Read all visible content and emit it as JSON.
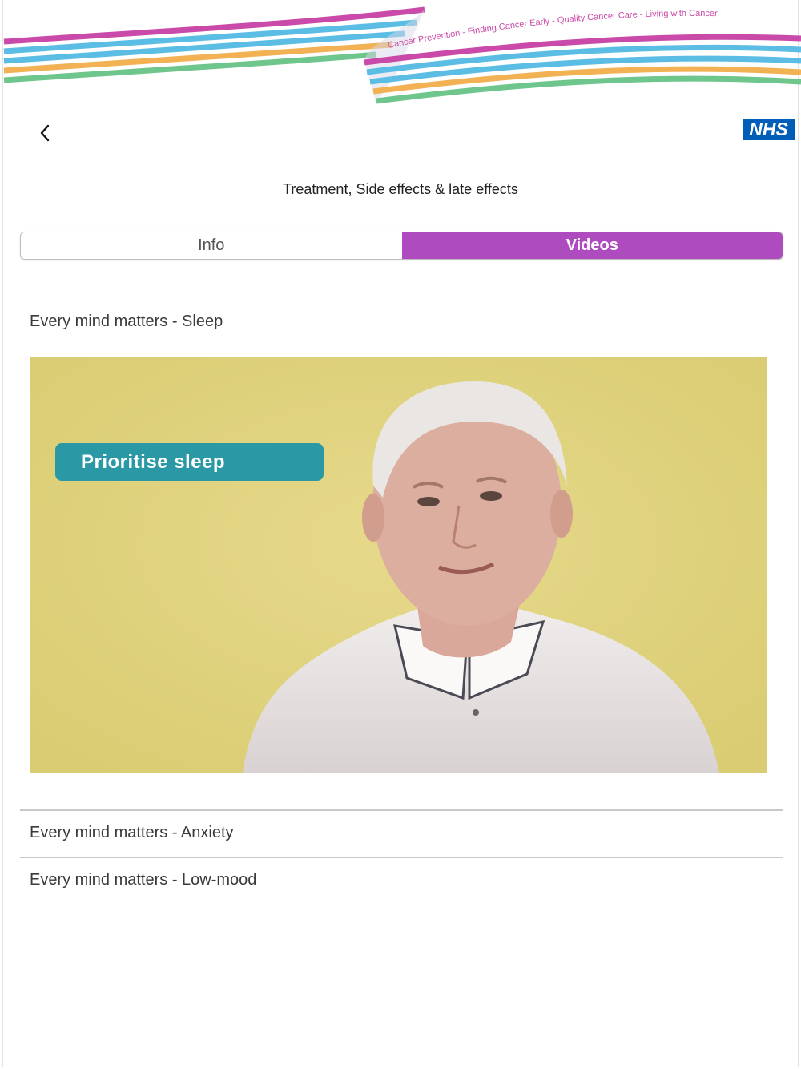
{
  "banner": {
    "tagline": "Cancer Prevention - Finding Cancer Early - Quality Cancer Care - Living with Cancer",
    "stripe_colors": [
      "#c94aa8",
      "#5bbde4",
      "#f2b254",
      "#6fc68c"
    ]
  },
  "header": {
    "back_icon": "chevron-left-icon",
    "logo_text": "NHS",
    "logo_color": "#005eb8",
    "title": "Treatment, Side effects & late effects"
  },
  "tabs": [
    {
      "label": "Info",
      "active": false
    },
    {
      "label": "Videos",
      "active": true
    }
  ],
  "accent_color": "#ad4bbf",
  "videos": {
    "expanded": {
      "title": "Every mind matters - Sleep",
      "caption": "Prioritise sleep"
    },
    "items": [
      {
        "title": "Every mind matters - Anxiety"
      },
      {
        "title": "Every mind matters - Low-mood"
      }
    ]
  }
}
